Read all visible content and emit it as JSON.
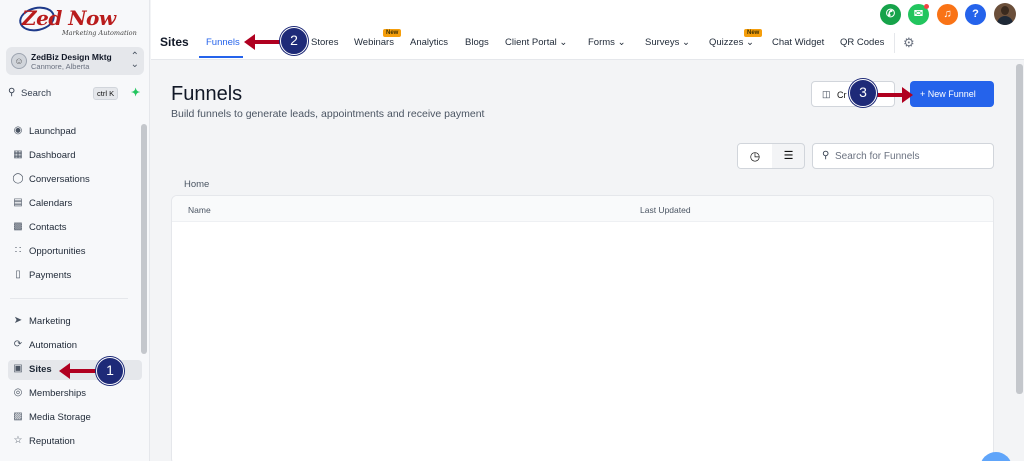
{
  "logo": {
    "brand": "Zed Now",
    "tagline": "Marketing Automation"
  },
  "account": {
    "name": "ZedBiz Design Mktg",
    "location": "Canmore, Alberta"
  },
  "sidebar_search": {
    "label": "Search",
    "shortcut": "ctrl K"
  },
  "sidebar": {
    "items": [
      {
        "label": "Launchpad",
        "icon": "rocket-icon"
      },
      {
        "label": "Dashboard",
        "icon": "grid-icon"
      },
      {
        "label": "Conversations",
        "icon": "chat-icon"
      },
      {
        "label": "Calendars",
        "icon": "calendar-icon"
      },
      {
        "label": "Contacts",
        "icon": "contacts-icon"
      },
      {
        "label": "Opportunities",
        "icon": "opportunities-icon"
      },
      {
        "label": "Payments",
        "icon": "payments-icon"
      },
      {
        "label": "Marketing",
        "icon": "send-icon"
      },
      {
        "label": "Automation",
        "icon": "automation-icon"
      },
      {
        "label": "Sites",
        "icon": "sites-icon",
        "active": true
      },
      {
        "label": "Memberships",
        "icon": "badge-icon"
      },
      {
        "label": "Media Storage",
        "icon": "image-icon"
      },
      {
        "label": "Reputation",
        "icon": "star-icon"
      }
    ]
  },
  "topbar": {
    "section_title": "Sites",
    "tabs": [
      {
        "label": "Funnels",
        "active": true
      },
      {
        "label": "Stores"
      },
      {
        "label": "Webinars",
        "badge": "New"
      },
      {
        "label": "Analytics"
      },
      {
        "label": "Blogs"
      },
      {
        "label": "Client Portal",
        "dropdown": true
      },
      {
        "label": "Forms",
        "dropdown": true
      },
      {
        "label": "Surveys",
        "dropdown": true
      },
      {
        "label": "Quizzes",
        "dropdown": true,
        "badge": "New"
      },
      {
        "label": "Chat Widget"
      },
      {
        "label": "QR Codes"
      }
    ],
    "header_icons": {
      "phone": {
        "icon": "phone-icon",
        "color": "#16a34a"
      },
      "announce": {
        "icon": "megaphone-icon",
        "color": "#22c55e"
      },
      "bell": {
        "icon": "bell-icon",
        "color": "#f97316"
      },
      "help": {
        "icon": "help-icon",
        "color": "#2563eb"
      }
    }
  },
  "main": {
    "title": "Funnels",
    "subtitle": "Build funnels to generate leads, appointments and receive payment",
    "create_button": "Cr",
    "new_funnel_button": "+ New Funnel",
    "search_placeholder": "Search for Funnels",
    "breadcrumb": "Home",
    "table_headers": {
      "name": "Name",
      "last_updated": "Last Updated"
    }
  },
  "annotations": {
    "step1": "1",
    "step2": "2",
    "step3": "3"
  },
  "colors": {
    "accent": "#2563eb",
    "annotation_arrow": "#b00020",
    "annotation_marker": "#1e2a78"
  }
}
